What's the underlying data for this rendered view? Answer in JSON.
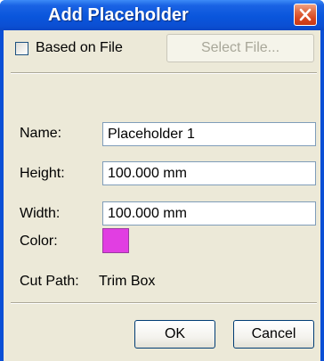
{
  "window": {
    "title": "Add Placeholder",
    "close_icon": "close-icon"
  },
  "based_on_file": {
    "label": "Based on File",
    "checked": false,
    "select_button": "Select File...",
    "select_button_enabled": false
  },
  "fields": {
    "name": {
      "label": "Name:",
      "value": "Placeholder 1"
    },
    "height": {
      "label": "Height:",
      "value": "100.000 mm"
    },
    "width": {
      "label": "Width:",
      "value": "100.000 mm"
    },
    "color": {
      "label": "Color:",
      "value": "#e13ee2"
    },
    "cut_path": {
      "label": "Cut Path:",
      "value": "Trim Box"
    }
  },
  "buttons": {
    "ok": "OK",
    "cancel": "Cancel"
  }
}
